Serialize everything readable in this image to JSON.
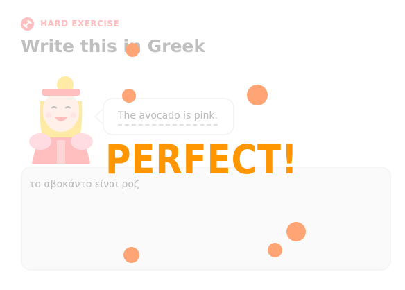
{
  "header": {
    "exercise_badge": "HARD EXERCISE",
    "badge_icon": "dumbbell-icon",
    "title": "Write this in Greek"
  },
  "prompt": {
    "sentence": "The avocado is pink.",
    "character": "character-illustration"
  },
  "answer": {
    "value": "το αβοκάντο είναι ροζ"
  },
  "feedback": {
    "message": "PERFECT!"
  },
  "colors": {
    "accent_red": "#ff4b4b",
    "feedback_orange": "#ff9600",
    "confetti": "#ffa575"
  }
}
